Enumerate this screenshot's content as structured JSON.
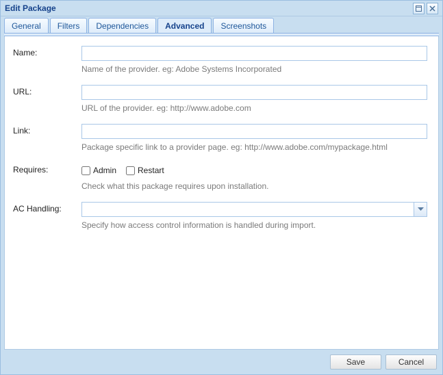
{
  "window": {
    "title": "Edit Package"
  },
  "tabs": {
    "general": "General",
    "filters": "Filters",
    "dependencies": "Dependencies",
    "advanced": "Advanced",
    "screenshots": "Screenshots"
  },
  "labels": {
    "name": "Name:",
    "url": "URL:",
    "link": "Link:",
    "requires": "Requires:",
    "ac_handling": "AC Handling:"
  },
  "hints": {
    "name": "Name of the provider. eg: Adobe Systems Incorporated",
    "url": "URL of the provider. eg: http://www.adobe.com",
    "link": "Package specific link to a provider page. eg: http://www.adobe.com/mypackage.html",
    "requires": "Check what this package requires upon installation.",
    "ac_handling": "Specify how access control information is handled during import."
  },
  "checks": {
    "admin": "Admin",
    "restart": "Restart"
  },
  "buttons": {
    "save": "Save",
    "cancel": "Cancel"
  },
  "values": {
    "name": "",
    "url": "",
    "link": "",
    "admin": false,
    "restart": false,
    "ac_handling": ""
  }
}
